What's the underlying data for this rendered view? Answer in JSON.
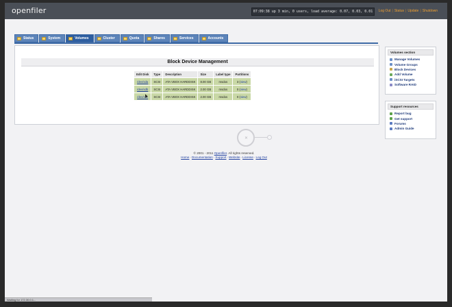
{
  "app": {
    "logo": "openfiler"
  },
  "topbar": {
    "uptime": "07:09:38 up 3 min, 0 users, load average: 0.07, 0.03, 0.01",
    "links": [
      "Log Out",
      "Status",
      "Update",
      "Shutdown"
    ]
  },
  "tabs": [
    {
      "label": "Status",
      "active": false
    },
    {
      "label": "System",
      "active": false
    },
    {
      "label": "Volumes",
      "active": true
    },
    {
      "label": "Cluster",
      "active": false
    },
    {
      "label": "Quota",
      "active": false
    },
    {
      "label": "Shares",
      "active": false
    },
    {
      "label": "Services",
      "active": false
    },
    {
      "label": "Accounts",
      "active": false
    }
  ],
  "main": {
    "title": "Block Device Management",
    "columns": [
      "Edit Disk",
      "Type",
      "Description",
      "Size",
      "Label type",
      "Partitions"
    ],
    "rows": [
      {
        "disk": "/dev/sda",
        "type": "SCSI",
        "description": "ATA VBOX HARDDISK",
        "size": "8.00 GB",
        "label": "msdos",
        "partitions_count": "3",
        "partitions_link": "view"
      },
      {
        "disk": "/dev/sdb",
        "type": "SCSI",
        "description": "ATA VBOX HARDDISK",
        "size": "2.00 GB",
        "label": "msdos",
        "partitions_count": "0",
        "partitions_link": "view"
      },
      {
        "disk": "/dev/sdc",
        "type": "SCSI",
        "description": "ATA VBOX HARDDISK",
        "size": "2.00 GB",
        "label": "msdos",
        "partitions_count": "0",
        "partitions_link": "view"
      }
    ]
  },
  "sidebar_volumes": {
    "title": "Volumes section",
    "items": [
      {
        "label": "Manage Volumes",
        "color": "#6a8fc6"
      },
      {
        "label": "Volume Groups",
        "color": "#6a8fc6"
      },
      {
        "label": "Block Devices",
        "color": "#c9a64a"
      },
      {
        "label": "Add Volume",
        "color": "#6aa85a"
      },
      {
        "label": "iSCSI Targets",
        "color": "#6a8fc6"
      },
      {
        "label": "Software RAID",
        "color": "#8a8ac6"
      }
    ]
  },
  "sidebar_support": {
    "title": "Support resources",
    "items": [
      {
        "label": "Report bug",
        "color": "#5aa04a"
      },
      {
        "label": "Get support",
        "color": "#5aa04a"
      },
      {
        "label": "Forums",
        "color": "#5a7ac0"
      },
      {
        "label": "Admin Guide",
        "color": "#5a7ac0"
      }
    ]
  },
  "footer": {
    "copyright": "© 2001 - 2011",
    "brand": "Openfiler",
    "rights": ". All rights reserved.",
    "links": [
      "Home",
      "Documentation",
      "Support",
      "Website",
      "License",
      "Log Out"
    ]
  },
  "statusbar": {
    "text": "Waiting for 172.30.0.1..."
  }
}
